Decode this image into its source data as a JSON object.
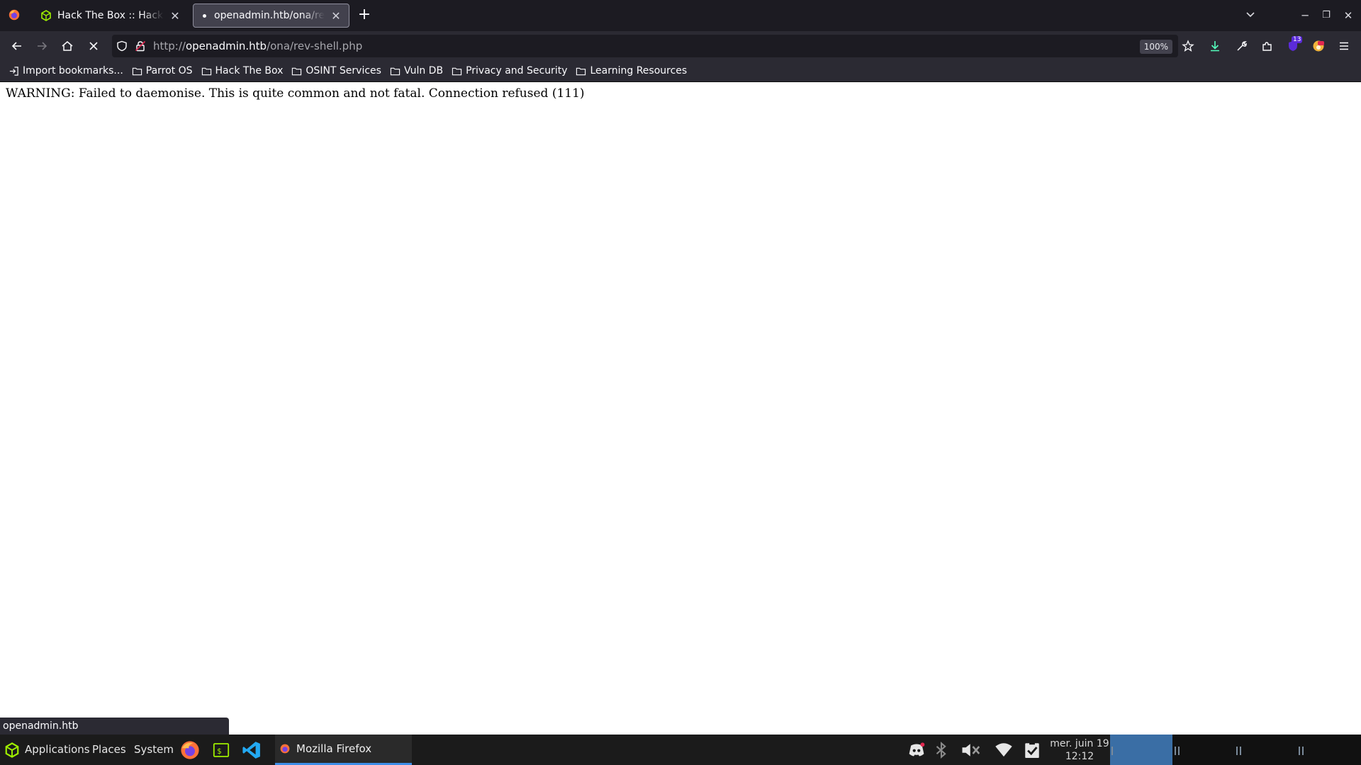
{
  "browser": {
    "tabs": [
      {
        "title": "Hack The Box :: Hack The Box",
        "icon": "hackthebox-cube-icon",
        "active": false
      },
      {
        "title": "openadmin.htb/ona/rev-shell.php",
        "icon": "loading-dot",
        "active": true
      }
    ],
    "url_scheme": "http://",
    "url_host": "openadmin.htb",
    "url_path": "/ona/rev-shell.php",
    "zoom": "100%",
    "extension_badge": "13",
    "bookmarks": [
      {
        "label": "Import bookmarks...",
        "icon": "import-icon"
      },
      {
        "label": "Parrot OS",
        "icon": "folder-icon"
      },
      {
        "label": "Hack The Box",
        "icon": "folder-icon"
      },
      {
        "label": "OSINT Services",
        "icon": "folder-icon"
      },
      {
        "label": "Vuln DB",
        "icon": "folder-icon"
      },
      {
        "label": "Privacy and Security",
        "icon": "folder-icon"
      },
      {
        "label": "Learning Resources",
        "icon": "folder-icon"
      }
    ],
    "status_link": "openadmin.htb"
  },
  "page": {
    "warning": "WARNING: Failed to daemonise. This is quite common and not fatal. Connection refused (111)"
  },
  "taskbar": {
    "menus": [
      "Applications",
      "Places",
      "System"
    ],
    "window_title": "Mozilla Firefox",
    "clock_date": "mer. juin 19",
    "clock_time": "12:12"
  },
  "colors": {
    "tabstrip_bg": "#1c1b22",
    "toolbar_bg": "#2b2a33",
    "taskbar_bg": "#1b1b1b",
    "accent": "#3d8ee8",
    "htb_green": "#9fef00"
  }
}
